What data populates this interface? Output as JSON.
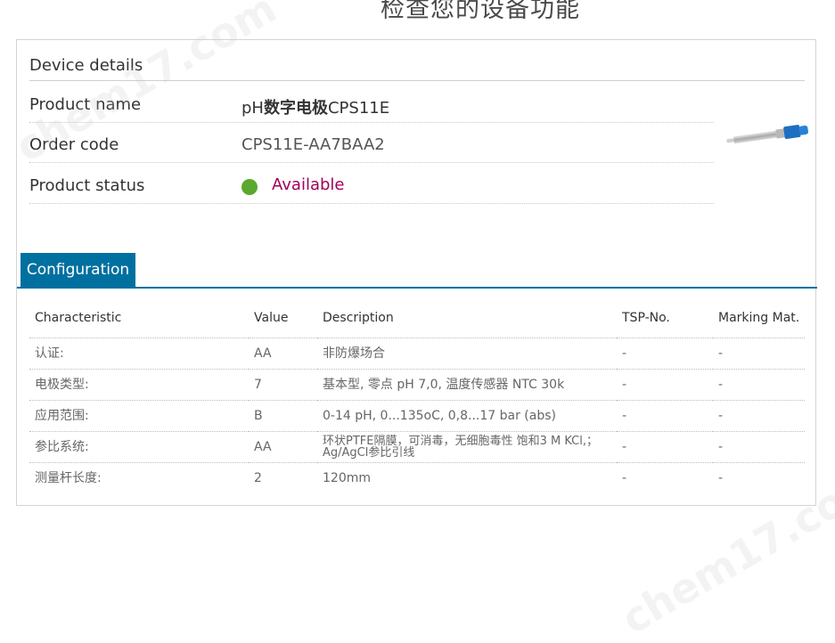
{
  "page": {
    "heading": "检查您的设备功能"
  },
  "device_details": {
    "title": "Device details",
    "product_name_label": "Product name",
    "product_name_prefix": "pH",
    "product_name_bold": "数字电极",
    "product_name_suffix": "CPS11E",
    "order_code_label": "Order code",
    "order_code_value": "CPS11E-AA7BAA2",
    "status_label": "Product status",
    "status_value": "Available",
    "status_color": "#5aa82e",
    "status_text_color": "#a0005a"
  },
  "configuration": {
    "tab_label": "Configuration",
    "accent": "#0070a0",
    "columns": [
      "Characteristic",
      "Value",
      "Description",
      "TSP-No.",
      "Marking Mat."
    ],
    "rows": [
      {
        "characteristic": "认证:",
        "value": "AA",
        "description": "非防爆场合",
        "tsp": "-",
        "marking": "-"
      },
      {
        "characteristic": "电极类型:",
        "value": "7",
        "description": "基本型, 零点 pH 7,0, 温度传感器 NTC 30k",
        "tsp": "-",
        "marking": "-"
      },
      {
        "characteristic": "应用范围:",
        "value": "B",
        "description": "0-14 pH, 0...135oC, 0,8...17 bar (abs)",
        "tsp": "-",
        "marking": "-"
      },
      {
        "characteristic": "参比系统:",
        "value": "AA",
        "description": "环状PTFE隔膜，可消毒，无细胞毒性 饱和3 M KCl,；Ag/AgCl参比引线",
        "tsp": "-",
        "marking": "-"
      },
      {
        "characteristic": "测量杆长度:",
        "value": "2",
        "description": "120mm",
        "tsp": "-",
        "marking": "-"
      }
    ]
  },
  "watermark": {
    "text": "chem17.com"
  }
}
